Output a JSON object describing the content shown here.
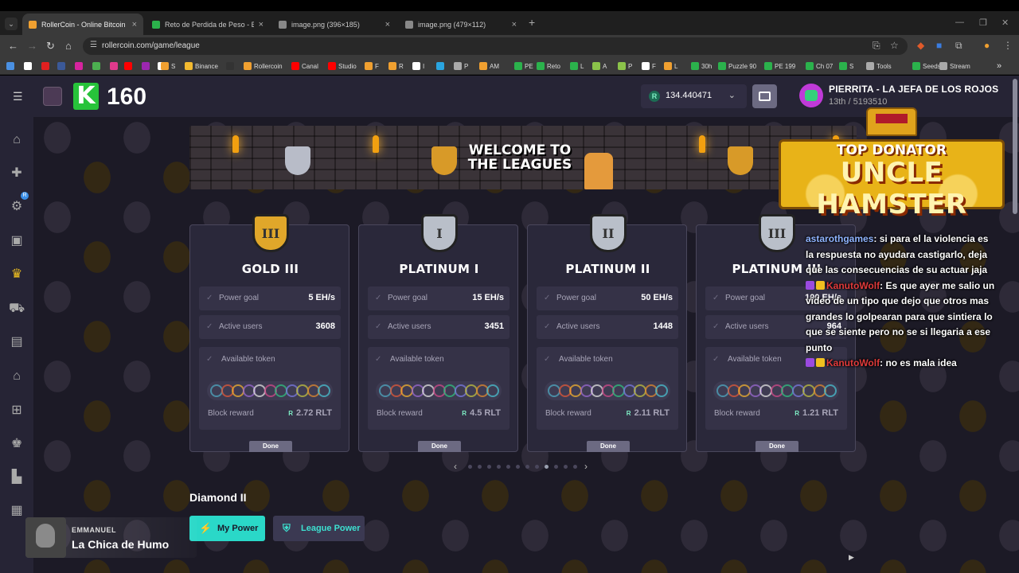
{
  "browser": {
    "tabs": [
      {
        "label": "RollerCoin - Online Bitcoin Min",
        "close": "×",
        "color": "#f0a030"
      },
      {
        "label": "Reto de Perdida de Peso - El M",
        "close": "×",
        "color": "#2bb24c"
      },
      {
        "label": "image.png (396×185)",
        "close": "×",
        "color": "#888888"
      },
      {
        "label": "image.png (479×112)",
        "close": "×",
        "color": "#888888"
      }
    ],
    "new_tab": "+",
    "url": "rollercoin.com/game/league",
    "bookmarks": [
      {
        "label": "",
        "color": "#4a90e2"
      },
      {
        "label": "",
        "color": "#ffffff"
      },
      {
        "label": "",
        "color": "#e02020"
      },
      {
        "label": "",
        "color": "#3b5998"
      },
      {
        "label": "",
        "color": "#d6249f"
      },
      {
        "label": "",
        "color": "#4caf50"
      },
      {
        "label": "",
        "color": "#e03a8c"
      },
      {
        "label": "",
        "color": "#ff0000"
      },
      {
        "label": "",
        "color": "#9c27b0"
      },
      {
        "label": "",
        "color": "#ffffff"
      },
      {
        "label": "S",
        "color": "#f0a030"
      },
      {
        "label": "Binance",
        "color": "#f3ba2f"
      },
      {
        "label": "",
        "color": "#333333"
      },
      {
        "label": "Rollercoin",
        "color": "#f0a030"
      },
      {
        "label": "Canal",
        "color": "#ff0000"
      },
      {
        "label": "Studio",
        "color": "#ff0000"
      },
      {
        "label": "F",
        "color": "#f0a030"
      },
      {
        "label": "R",
        "color": "#f0a030"
      },
      {
        "label": "I",
        "color": "#ffffff"
      },
      {
        "label": "",
        "color": "#2aa5e0"
      },
      {
        "label": "P",
        "color": "#aaaaaa"
      },
      {
        "label": "AM",
        "color": "#f0a030"
      },
      {
        "label": "PE",
        "color": "#2bb24c"
      },
      {
        "label": "Reto",
        "color": "#2bb24c"
      },
      {
        "label": "L",
        "color": "#2bb24c"
      },
      {
        "label": "A",
        "color": "#8bc34a"
      },
      {
        "label": "P",
        "color": "#8bc34a"
      },
      {
        "label": "F",
        "color": "#ffffff"
      },
      {
        "label": "L",
        "color": "#f0a030"
      },
      {
        "label": "30h",
        "color": "#2bb24c"
      },
      {
        "label": "Puzzle 90",
        "color": "#2bb24c"
      },
      {
        "label": "PE 199",
        "color": "#2bb24c"
      },
      {
        "label": "Ch 07",
        "color": "#2bb24c"
      },
      {
        "label": "S",
        "color": "#2bb24c"
      },
      {
        "label": "Tools",
        "color": "#aaaaaa"
      },
      {
        "label": "Seeds",
        "color": "#2bb24c"
      },
      {
        "label": "Stream",
        "color": "#aaaaaa"
      }
    ],
    "more_bookmarks": "»"
  },
  "header": {
    "k_letter": "K",
    "k_count": "160",
    "balance_currency": "R",
    "balance": "134.440471",
    "username": "PIERRITA - LA JEFA DE LOS ROJOS",
    "rank": "13th / 5193510"
  },
  "banner": {
    "title_line1": "WELCOME TO",
    "title_line2": "THE LEAGUES"
  },
  "donator": {
    "top": "TOP DONATOR",
    "name": "UNCLE HAMSTER"
  },
  "leagues": [
    {
      "medal": "III",
      "tier": "gold",
      "name": "GOLD III",
      "power_goal_label": "Power goal",
      "power_goal": "5 EH/s",
      "active_users_label": "Active users",
      "active_users": "3608",
      "token_label": "Available token",
      "reward_label": "Block reward",
      "reward_currency": "R",
      "reward": "2.72 RLT",
      "button": "Done"
    },
    {
      "medal": "I",
      "tier": "plat",
      "name": "PLATINUM I",
      "power_goal_label": "Power goal",
      "power_goal": "15 EH/s",
      "active_users_label": "Active users",
      "active_users": "3451",
      "token_label": "Available token",
      "reward_label": "Block reward",
      "reward_currency": "R",
      "reward": "4.5 RLT",
      "button": "Done"
    },
    {
      "medal": "II",
      "tier": "plat",
      "name": "PLATINUM II",
      "power_goal_label": "Power goal",
      "power_goal": "50 EH/s",
      "active_users_label": "Active users",
      "active_users": "1448",
      "token_label": "Available token",
      "reward_label": "Block reward",
      "reward_currency": "R",
      "reward": "2.11 RLT",
      "button": "Done"
    },
    {
      "medal": "III",
      "tier": "plat",
      "name": "PLATINUM III",
      "power_goal_label": "Power goal",
      "power_goal": "100 EH/s",
      "active_users_label": "Active users",
      "active_users": "964",
      "token_label": "Available token",
      "reward_label": "Block reward",
      "reward_currency": "R",
      "reward": "1.21 RLT",
      "button": "Done"
    }
  ],
  "token_colors": [
    "#4fa8c0",
    "#e05a3a",
    "#f0b030",
    "#9a6ad0",
    "#e0e0e0",
    "#d04a8a",
    "#30c080",
    "#7a7ae0",
    "#c0c040",
    "#e08a30",
    "#4ac0d0"
  ],
  "pager": {
    "prev": "‹",
    "next": "›",
    "count": 12,
    "active": 9
  },
  "section": {
    "title": "Diamond II",
    "my_power": "My Power",
    "league_power": "League Power"
  },
  "chat": [
    {
      "user": "astarothgames",
      "text": ": si para el la violencia es la respuesta no ayudara castigarlo, deja que las consecuencias de su actuar jaja"
    },
    {
      "user": "KanutoWolf",
      "text": ": Es que ayer me salio un video de un tipo que dejo que otros mas grandes lo golpearan para que sintiera lo que se siente pero no se si llegaria a ese punto"
    },
    {
      "user": "KanutoWolf",
      "text": ": no es mala idea"
    }
  ],
  "music": {
    "artist": "EMMANUEL",
    "song": "La Chica de Humo"
  }
}
